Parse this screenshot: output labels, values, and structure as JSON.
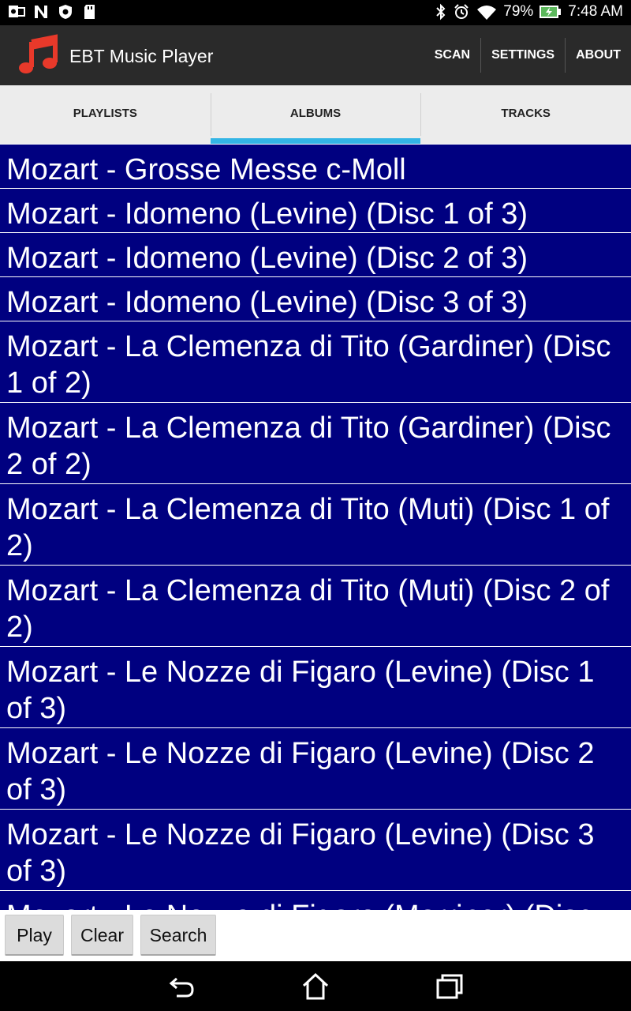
{
  "status_bar": {
    "left_icons": [
      "outlook-icon",
      "n-app-icon",
      "shield-icon",
      "sd-card-icon"
    ],
    "battery": "79%",
    "time": "7:48 AM"
  },
  "action_bar": {
    "title": "EBT Music Player",
    "actions": [
      "SCAN",
      "SETTINGS",
      "ABOUT"
    ]
  },
  "tabs": [
    "PLAYLISTS",
    "ALBUMS",
    "TRACKS"
  ],
  "active_tab": "ALBUMS",
  "colors": {
    "list_bg": "#000080",
    "accent": "#33b5e5",
    "actionbar": "#2a2a2a",
    "logo": "#e8392a"
  },
  "albums": [
    "Mozart - Grosse Messe c-Moll",
    "Mozart - Idomeno (Levine) (Disc 1 of 3)",
    "Mozart - Idomeno (Levine) (Disc 2 of 3)",
    "Mozart - Idomeno (Levine) (Disc 3 of 3)",
    "Mozart - La Clemenza di Tito (Gardiner) (Disc 1 of 2)",
    "Mozart - La Clemenza di Tito (Gardiner) (Disc 2 of 2)",
    "Mozart - La Clemenza di Tito (Muti) (Disc 1 of 2)",
    "Mozart - La Clemenza di Tito (Muti) (Disc 2 of 2)",
    "Mozart - Le Nozze di Figaro (Levine) (Disc 1 of 3)",
    "Mozart - Le Nozze di Figaro (Levine) (Disc 2 of 3)",
    "Mozart - Le Nozze di Figaro (Levine) (Disc 3 of 3)",
    "Mozart - Le Nozze di Figaro (Marriner) (Disc"
  ],
  "buttons": {
    "play": "Play",
    "clear": "Clear",
    "search": "Search"
  },
  "nav": [
    "back-icon",
    "home-icon",
    "recent-apps-icon"
  ]
}
